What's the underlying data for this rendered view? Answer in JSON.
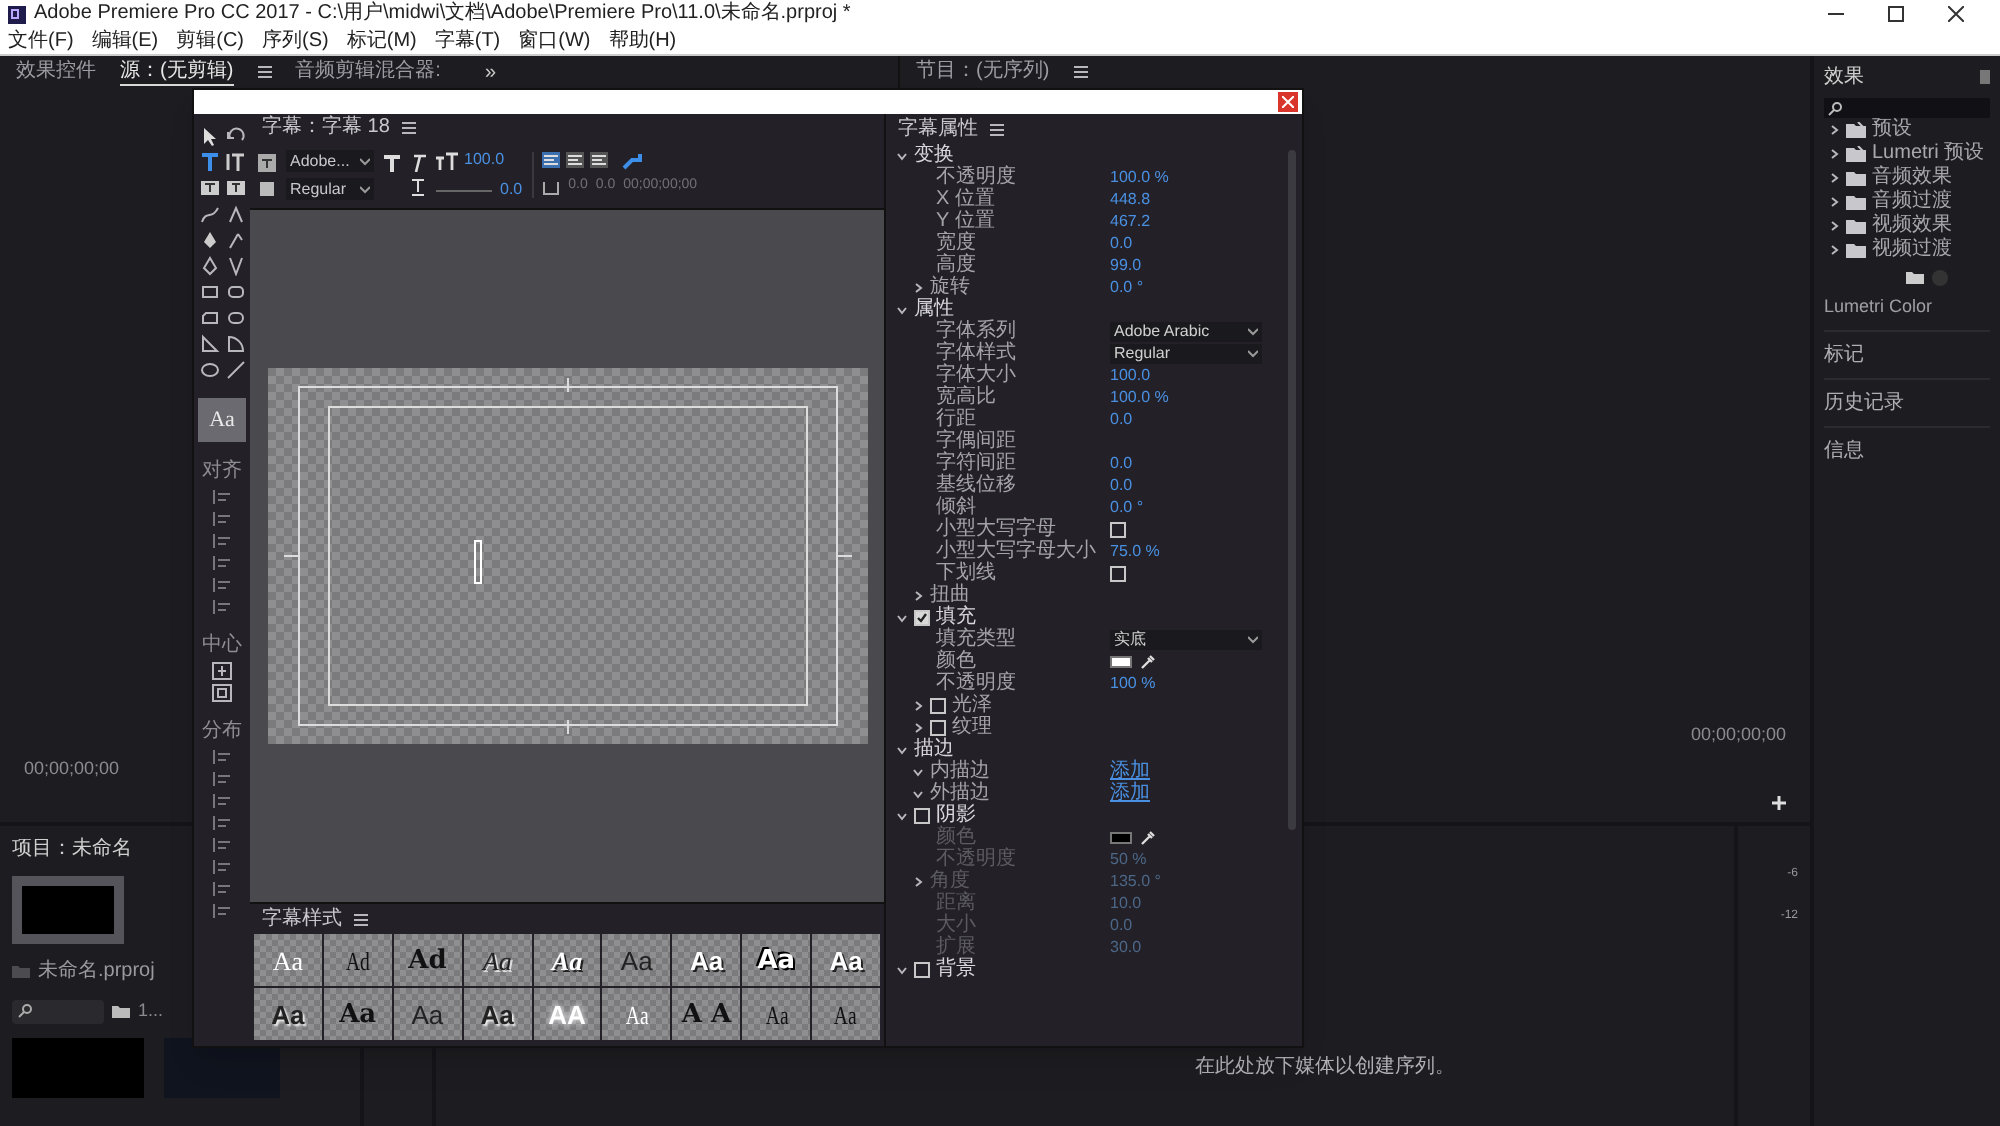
{
  "window": {
    "title": "Adobe Premiere Pro CC 2017 - C:\\用户\\midwi\\文档\\Adobe\\Premiere Pro\\11.0\\未命名.prproj *"
  },
  "menu": [
    "文件(F)",
    "编辑(E)",
    "剪辑(C)",
    "序列(S)",
    "标记(M)",
    "字幕(T)",
    "窗口(W)",
    "帮助(H)"
  ],
  "source_panel": {
    "tabs": [
      {
        "label": "效果控件",
        "selected": false,
        "menu": false
      },
      {
        "label": "源：(无剪辑)",
        "selected": true,
        "menu": true
      },
      {
        "label": "音频剪辑混合器:",
        "selected": false,
        "menu": false
      }
    ],
    "overflow": "»",
    "timecode": "00;00;00;00"
  },
  "program_panel": {
    "tabs": [
      {
        "label": "节目：(无序列)",
        "selected": false,
        "menu": true
      }
    ],
    "timecode": "00;00;00;00"
  },
  "effects_panel": {
    "title": "效果",
    "items": [
      {
        "label": "预设",
        "kind": "preset",
        "expanded": false
      },
      {
        "label": "Lumetri 预设",
        "kind": "preset",
        "expanded": false
      },
      {
        "label": "音频效果",
        "kind": "folder",
        "expanded": false
      },
      {
        "label": "音频过渡",
        "kind": "folder",
        "expanded": false
      },
      {
        "label": "视频效果",
        "kind": "folder",
        "expanded": false
      },
      {
        "label": "视频过渡",
        "kind": "folder",
        "expanded": false
      }
    ],
    "sections": [
      "Lumetri Color",
      "标记",
      "历史记录",
      "信息"
    ]
  },
  "project_panel": {
    "title": "项目：未命名",
    "file": "未命名.prproj",
    "count": "1..."
  },
  "timeline": {
    "drop_hint": "在此处放下媒体以创建序列。",
    "meter_ticks": [
      "-6",
      "-12"
    ]
  },
  "titler": {
    "title_tab": "字幕：字幕 18",
    "align_label": "对齐",
    "center_label": "中心",
    "distribute_label": "分布",
    "style_sample": "Aa",
    "toolbar": {
      "font_family": "Adobe...",
      "font_style": "Regular",
      "font_size": "100.0",
      "tracking": "0.0",
      "tab_a": "0.0",
      "tab_b": "0.0",
      "timecode": "00;00;00;00"
    },
    "styles": {
      "title": "字幕样式",
      "swatches": [
        {
          "text": "Aa",
          "kind": "serif"
        },
        {
          "text": "Ad",
          "kind": "condensed"
        },
        {
          "text": "Ad",
          "kind": "outline"
        },
        {
          "text": "Aa",
          "kind": "script"
        },
        {
          "text": "Aa",
          "kind": "script-white"
        },
        {
          "text": "Aa",
          "kind": "thin"
        },
        {
          "text": "Aa",
          "kind": "bold-white"
        },
        {
          "text": "Aa",
          "kind": "heavy"
        },
        {
          "text": "Aa",
          "kind": "bold-white"
        },
        {
          "text": "Aa",
          "kind": "shadow"
        },
        {
          "text": "Aa",
          "kind": "outline"
        },
        {
          "text": "Aa",
          "kind": "small"
        },
        {
          "text": "Aa",
          "kind": "shadow"
        },
        {
          "text": "AA",
          "kind": "glow"
        },
        {
          "text": "Aa",
          "kind": "condensed-white"
        },
        {
          "text": "A A",
          "kind": "outline"
        },
        {
          "text": "Aa",
          "kind": "condensed"
        },
        {
          "text": "Aa",
          "kind": "condensed"
        }
      ]
    },
    "properties": {
      "title": "字幕属性",
      "rows": [
        {
          "kind": "section",
          "label": "变换",
          "expanded": true,
          "children": [
            {
              "kind": "value",
              "label": "不透明度",
              "value": "100.0 %"
            },
            {
              "kind": "value",
              "label": "X 位置",
              "value": "448.8"
            },
            {
              "kind": "value",
              "label": "Y 位置",
              "value": "467.2"
            },
            {
              "kind": "value",
              "label": "宽度",
              "value": "0.0"
            },
            {
              "kind": "value",
              "label": "高度",
              "value": "99.0"
            },
            {
              "kind": "group",
              "label": "旋转",
              "expanded": false,
              "value": "0.0 °"
            }
          ]
        },
        {
          "kind": "section",
          "label": "属性",
          "expanded": true,
          "children": [
            {
              "kind": "dropdown",
              "label": "字体系列",
              "value": "Adobe Arabic"
            },
            {
              "kind": "dropdown",
              "label": "字体样式",
              "value": "Regular"
            },
            {
              "kind": "value",
              "label": "字体大小",
              "value": "100.0"
            },
            {
              "kind": "value",
              "label": "宽高比",
              "value": "100.0 %"
            },
            {
              "kind": "value",
              "label": "行距",
              "value": "0.0"
            },
            {
              "kind": "value",
              "label": "字偶间距"
            },
            {
              "kind": "value",
              "label": "字符间距",
              "value": "0.0"
            },
            {
              "kind": "value",
              "label": "基线位移",
              "value": "0.0"
            },
            {
              "kind": "value",
              "label": "倾斜",
              "value": "0.0 °"
            },
            {
              "kind": "checkbox",
              "label": "小型大写字母",
              "checked": false
            },
            {
              "kind": "value",
              "label": "小型大写字母大小",
              "value": "75.0 %"
            },
            {
              "kind": "checkbox",
              "label": "下划线",
              "checked": false
            },
            {
              "kind": "group",
              "label": "扭曲",
              "expanded": false
            }
          ]
        },
        {
          "kind": "section",
          "label": "填充",
          "expanded": true,
          "checked": true,
          "children": [
            {
              "kind": "dropdown",
              "label": "填充类型",
              "value": "实底"
            },
            {
              "kind": "color",
              "label": "颜色",
              "color": "#ffffff"
            },
            {
              "kind": "value",
              "label": "不透明度",
              "value": "100 %"
            },
            {
              "kind": "group",
              "label": "光泽",
              "expanded": false,
              "checked": false
            },
            {
              "kind": "group",
              "label": "纹理",
              "expanded": false,
              "checked": false
            }
          ]
        },
        {
          "kind": "section",
          "label": "描边",
          "expanded": true,
          "children": [
            {
              "kind": "link",
              "label": "内描边",
              "expanded": true,
              "value": "添加"
            },
            {
              "kind": "link",
              "label": "外描边",
              "expanded": true,
              "value": "添加"
            }
          ]
        },
        {
          "kind": "section",
          "label": "阴影",
          "expanded": true,
          "checked": false,
          "children": [
            {
              "kind": "color",
              "label": "颜色",
              "color": "#000000"
            },
            {
              "kind": "value",
              "label": "不透明度",
              "value": "50 %"
            },
            {
              "kind": "group",
              "label": "角度",
              "expanded": false,
              "value": "135.0 °"
            },
            {
              "kind": "value",
              "label": "距离",
              "value": "10.0"
            },
            {
              "kind": "value",
              "label": "大小",
              "value": "0.0"
            },
            {
              "kind": "value",
              "label": "扩展",
              "value": "30.0"
            }
          ]
        },
        {
          "kind": "section",
          "label": "背景",
          "expanded": true,
          "checked": false,
          "children": []
        }
      ]
    }
  }
}
